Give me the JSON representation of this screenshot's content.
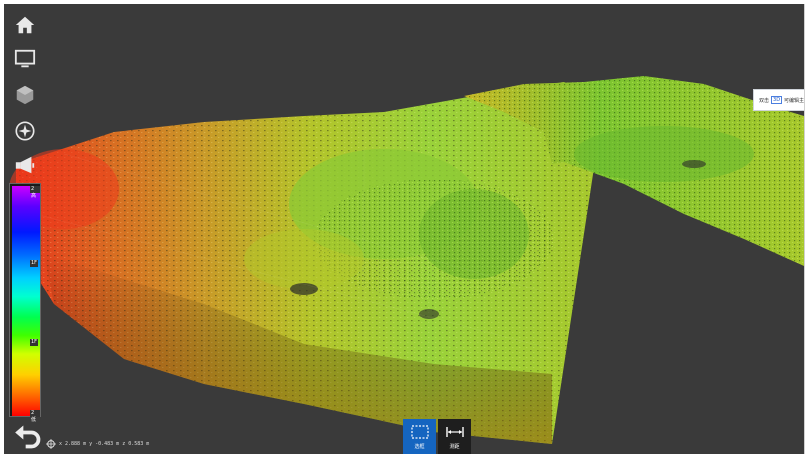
{
  "toolbar": {
    "items": [
      {
        "name": "home-icon"
      },
      {
        "name": "monitor-icon"
      },
      {
        "name": "cube-icon"
      },
      {
        "name": "compass-icon"
      },
      {
        "name": "megaphone-icon"
      }
    ]
  },
  "colorbar": {
    "labels": [
      "2高",
      "1F",
      "1F",
      "2低"
    ],
    "gradient": [
      "#cc00ff",
      "#0018ff",
      "#00d0ff",
      "#00ff50",
      "#d0ff00",
      "#ffd000",
      "#ff0000"
    ]
  },
  "coordinates": {
    "x_label": "x",
    "x_value": "2.888",
    "x_unit": "m",
    "y_label": "y",
    "y_value": "-0.483",
    "y_unit": "m",
    "z_label": "z",
    "z_value": "0.583",
    "z_unit": "m"
  },
  "modes": {
    "select_label": "选框",
    "measure_label": "测距"
  },
  "tooltip": {
    "prefix": "双击",
    "badge": "3D",
    "suffix": "可编辑主"
  },
  "colors": {
    "viewport_bg": "#3a3a3a",
    "accent": "#1565c0"
  }
}
